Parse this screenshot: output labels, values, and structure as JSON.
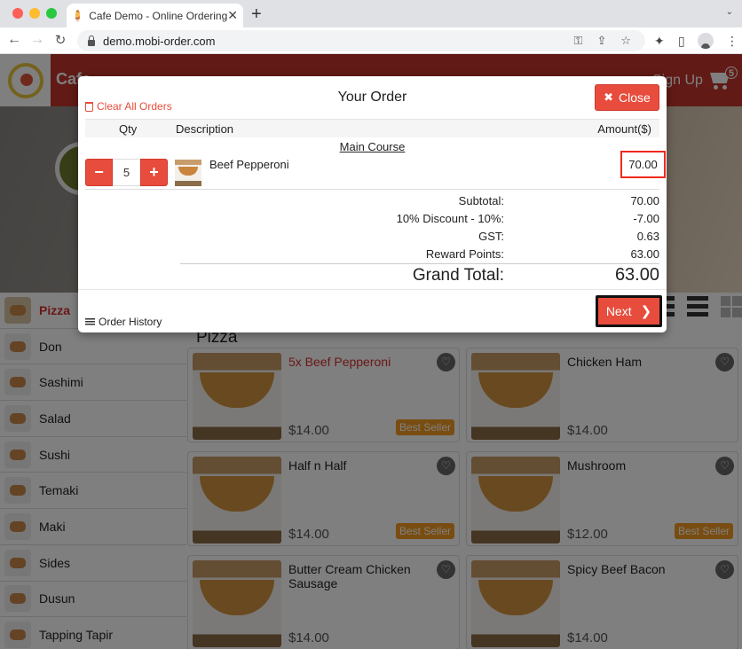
{
  "browser": {
    "tab_title": "Cafe Demo - Online Ordering",
    "tab_close": "✕",
    "new_tab": "+",
    "tab_menu": "⌄",
    "url": "demo.mobi-order.com",
    "icons": {
      "back": "←",
      "forward": "→",
      "reload": "↻",
      "key": "⚿",
      "share": "⇪",
      "star": "☆",
      "extensions": "✦",
      "sidepanel": "▯",
      "menu": "⋮"
    }
  },
  "site": {
    "title": "Cafe",
    "signup": "Sign Up",
    "cart_count": "5",
    "accent_color": "#c3352b"
  },
  "sidebar": {
    "items": [
      {
        "label": "Pizza",
        "active": true
      },
      {
        "label": "Don"
      },
      {
        "label": "Sashimi"
      },
      {
        "label": "Salad"
      },
      {
        "label": "Sushi"
      },
      {
        "label": "Temaki"
      },
      {
        "label": "Maki"
      },
      {
        "label": "Sides"
      },
      {
        "label": "Dusun"
      },
      {
        "label": "Tapping Tapir"
      }
    ]
  },
  "content": {
    "section_title": "Pizza",
    "products": [
      {
        "name": "5x Beef Pepperoni",
        "price": "$14.00",
        "badge": "Best Seller",
        "in_order": true
      },
      {
        "name": "Chicken Ham",
        "price": "$14.00",
        "badge": ""
      },
      {
        "name": "Half n Half",
        "price": "$14.00",
        "badge": "Best Seller"
      },
      {
        "name": "Mushroom",
        "price": "$12.00",
        "badge": "Best Seller"
      },
      {
        "name": "Butter Cream Chicken Sausage",
        "price": "$14.00",
        "badge": ""
      },
      {
        "name": "Spicy Beef Bacon",
        "price": "$14.00",
        "badge": ""
      }
    ]
  },
  "modal": {
    "title": "Your Order",
    "clear_all": "Clear All Orders",
    "close_label": "Close",
    "close_icon": "✖",
    "columns": {
      "qty": "Qty",
      "description": "Description",
      "amount": "Amount($)"
    },
    "group_label": "Main Course",
    "items": [
      {
        "name": "Beef Pepperoni",
        "qty": "5",
        "amount": "70.00",
        "minus": "−",
        "plus": "+"
      }
    ],
    "summary": [
      {
        "label": "Subtotal:",
        "value": "70.00"
      },
      {
        "label": "10% Discount - 10%:",
        "value": "-7.00"
      },
      {
        "label": "GST:",
        "value": "0.63"
      },
      {
        "label": "Reward Points:",
        "value": "63.00"
      }
    ],
    "grand_total": {
      "label": "Grand Total:",
      "value": "63.00"
    },
    "order_history": "Order History",
    "next_label": "Next",
    "next_icon": "❯"
  }
}
